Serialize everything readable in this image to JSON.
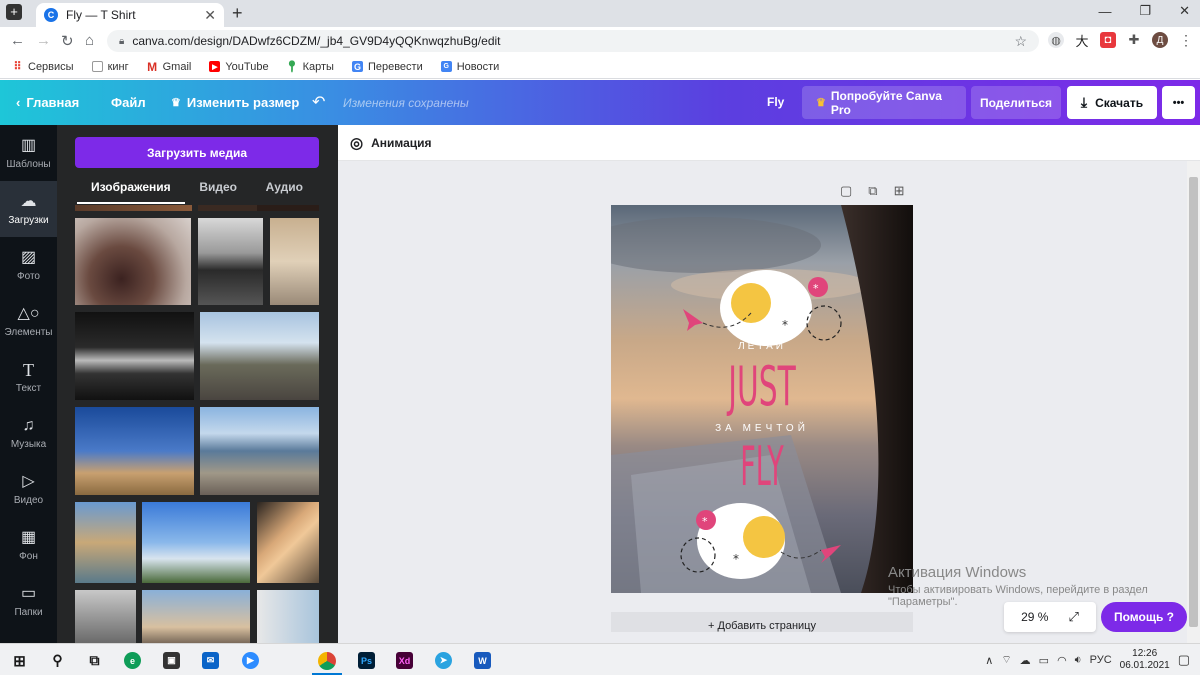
{
  "browser": {
    "tab_title": "Fly — T Shirt",
    "tab_favicon": "C",
    "new_tab": "+",
    "url": "canva.com/design/DADwfz6CDZM/_jb4_GV9D4yQQKnwqzhuBg/edit",
    "profile_initial": "Д",
    "bookmarks": [
      {
        "label": "Сервисы",
        "icon": "apps-grid-icon"
      },
      {
        "label": "кинг",
        "icon": "page-icon"
      },
      {
        "label": "Gmail",
        "icon": "gmail-icon"
      },
      {
        "label": "YouTube",
        "icon": "youtube-icon"
      },
      {
        "label": "Карты",
        "icon": "maps-icon"
      },
      {
        "label": "Перевести",
        "icon": "translate-icon"
      },
      {
        "label": "Новости",
        "icon": "news-icon"
      }
    ]
  },
  "canva_header": {
    "home": "Главная",
    "file": "Файл",
    "resize": "Изменить размер",
    "saved": "Изменения сохранены",
    "design_name": "Fly",
    "try_pro": "Попробуйте Canva Pro",
    "share": "Поделиться",
    "download": "Скачать",
    "more": "•••"
  },
  "rail": [
    {
      "label": "Шаблоны",
      "icon": "templates-icon"
    },
    {
      "label": "Загрузки",
      "icon": "upload-cloud-icon",
      "active": true
    },
    {
      "label": "Фото",
      "icon": "photo-icon"
    },
    {
      "label": "Элементы",
      "icon": "elements-icon"
    },
    {
      "label": "Текст",
      "icon": "text-icon"
    },
    {
      "label": "Музыка",
      "icon": "music-icon"
    },
    {
      "label": "Видео",
      "icon": "video-icon"
    },
    {
      "label": "Фон",
      "icon": "background-icon"
    },
    {
      "label": "Папки",
      "icon": "folder-icon"
    }
  ],
  "panel": {
    "upload_button": "Загрузить медиа",
    "tabs": [
      "Изображения",
      "Видео",
      "Аудио"
    ],
    "active_tab": 0
  },
  "editor": {
    "animation": "Анимация",
    "add_page": "+ Добавить страницу",
    "zoom": "29 %",
    "help": "Помощь  ?"
  },
  "design_text": {
    "line1": "ЛЕТАЙ",
    "line2": "JUST",
    "line3": "ЗА МЕЧТОЙ",
    "line4": "FLY"
  },
  "windows_activation": {
    "title": "Активация Windows",
    "body1": "Чтобы активировать Windows, перейдите в раздел",
    "body2": "\"Параметры\"."
  },
  "taskbar": {
    "lang": "РУС",
    "time": "12:26",
    "date": "06.01.2021",
    "apps": [
      "Ps",
      "Xd",
      "W"
    ]
  },
  "colors": {
    "accent": "#7d2ae8",
    "pink": "#e0457b",
    "yellow": "#f4c542"
  }
}
